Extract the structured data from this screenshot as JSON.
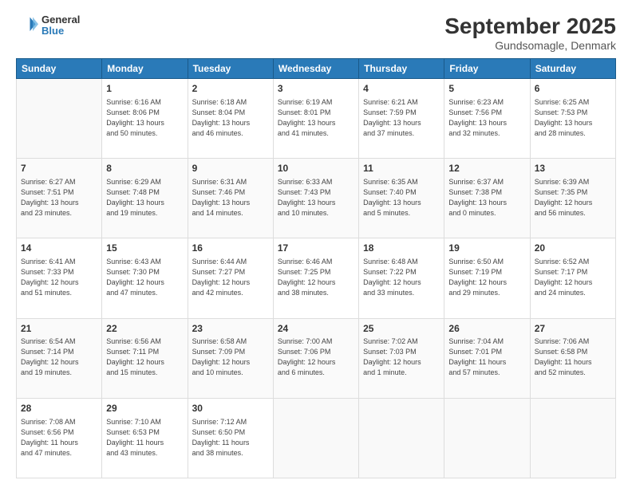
{
  "header": {
    "logo_line1": "General",
    "logo_line2": "Blue",
    "title": "September 2025",
    "subtitle": "Gundsomagle, Denmark"
  },
  "columns": [
    "Sunday",
    "Monday",
    "Tuesday",
    "Wednesday",
    "Thursday",
    "Friday",
    "Saturday"
  ],
  "weeks": [
    [
      {
        "day": "",
        "info": ""
      },
      {
        "day": "1",
        "info": "Sunrise: 6:16 AM\nSunset: 8:06 PM\nDaylight: 13 hours\nand 50 minutes."
      },
      {
        "day": "2",
        "info": "Sunrise: 6:18 AM\nSunset: 8:04 PM\nDaylight: 13 hours\nand 46 minutes."
      },
      {
        "day": "3",
        "info": "Sunrise: 6:19 AM\nSunset: 8:01 PM\nDaylight: 13 hours\nand 41 minutes."
      },
      {
        "day": "4",
        "info": "Sunrise: 6:21 AM\nSunset: 7:59 PM\nDaylight: 13 hours\nand 37 minutes."
      },
      {
        "day": "5",
        "info": "Sunrise: 6:23 AM\nSunset: 7:56 PM\nDaylight: 13 hours\nand 32 minutes."
      },
      {
        "day": "6",
        "info": "Sunrise: 6:25 AM\nSunset: 7:53 PM\nDaylight: 13 hours\nand 28 minutes."
      }
    ],
    [
      {
        "day": "7",
        "info": "Sunrise: 6:27 AM\nSunset: 7:51 PM\nDaylight: 13 hours\nand 23 minutes."
      },
      {
        "day": "8",
        "info": "Sunrise: 6:29 AM\nSunset: 7:48 PM\nDaylight: 13 hours\nand 19 minutes."
      },
      {
        "day": "9",
        "info": "Sunrise: 6:31 AM\nSunset: 7:46 PM\nDaylight: 13 hours\nand 14 minutes."
      },
      {
        "day": "10",
        "info": "Sunrise: 6:33 AM\nSunset: 7:43 PM\nDaylight: 13 hours\nand 10 minutes."
      },
      {
        "day": "11",
        "info": "Sunrise: 6:35 AM\nSunset: 7:40 PM\nDaylight: 13 hours\nand 5 minutes."
      },
      {
        "day": "12",
        "info": "Sunrise: 6:37 AM\nSunset: 7:38 PM\nDaylight: 13 hours\nand 0 minutes."
      },
      {
        "day": "13",
        "info": "Sunrise: 6:39 AM\nSunset: 7:35 PM\nDaylight: 12 hours\nand 56 minutes."
      }
    ],
    [
      {
        "day": "14",
        "info": "Sunrise: 6:41 AM\nSunset: 7:33 PM\nDaylight: 12 hours\nand 51 minutes."
      },
      {
        "day": "15",
        "info": "Sunrise: 6:43 AM\nSunset: 7:30 PM\nDaylight: 12 hours\nand 47 minutes."
      },
      {
        "day": "16",
        "info": "Sunrise: 6:44 AM\nSunset: 7:27 PM\nDaylight: 12 hours\nand 42 minutes."
      },
      {
        "day": "17",
        "info": "Sunrise: 6:46 AM\nSunset: 7:25 PM\nDaylight: 12 hours\nand 38 minutes."
      },
      {
        "day": "18",
        "info": "Sunrise: 6:48 AM\nSunset: 7:22 PM\nDaylight: 12 hours\nand 33 minutes."
      },
      {
        "day": "19",
        "info": "Sunrise: 6:50 AM\nSunset: 7:19 PM\nDaylight: 12 hours\nand 29 minutes."
      },
      {
        "day": "20",
        "info": "Sunrise: 6:52 AM\nSunset: 7:17 PM\nDaylight: 12 hours\nand 24 minutes."
      }
    ],
    [
      {
        "day": "21",
        "info": "Sunrise: 6:54 AM\nSunset: 7:14 PM\nDaylight: 12 hours\nand 19 minutes."
      },
      {
        "day": "22",
        "info": "Sunrise: 6:56 AM\nSunset: 7:11 PM\nDaylight: 12 hours\nand 15 minutes."
      },
      {
        "day": "23",
        "info": "Sunrise: 6:58 AM\nSunset: 7:09 PM\nDaylight: 12 hours\nand 10 minutes."
      },
      {
        "day": "24",
        "info": "Sunrise: 7:00 AM\nSunset: 7:06 PM\nDaylight: 12 hours\nand 6 minutes."
      },
      {
        "day": "25",
        "info": "Sunrise: 7:02 AM\nSunset: 7:03 PM\nDaylight: 12 hours\nand 1 minute."
      },
      {
        "day": "26",
        "info": "Sunrise: 7:04 AM\nSunset: 7:01 PM\nDaylight: 11 hours\nand 57 minutes."
      },
      {
        "day": "27",
        "info": "Sunrise: 7:06 AM\nSunset: 6:58 PM\nDaylight: 11 hours\nand 52 minutes."
      }
    ],
    [
      {
        "day": "28",
        "info": "Sunrise: 7:08 AM\nSunset: 6:56 PM\nDaylight: 11 hours\nand 47 minutes."
      },
      {
        "day": "29",
        "info": "Sunrise: 7:10 AM\nSunset: 6:53 PM\nDaylight: 11 hours\nand 43 minutes."
      },
      {
        "day": "30",
        "info": "Sunrise: 7:12 AM\nSunset: 6:50 PM\nDaylight: 11 hours\nand 38 minutes."
      },
      {
        "day": "",
        "info": ""
      },
      {
        "day": "",
        "info": ""
      },
      {
        "day": "",
        "info": ""
      },
      {
        "day": "",
        "info": ""
      }
    ]
  ]
}
